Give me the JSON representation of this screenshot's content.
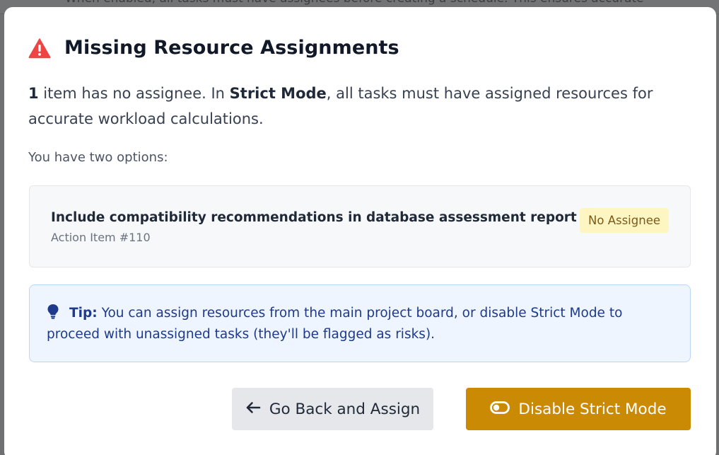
{
  "background": {
    "partial_text": "When enabled, all tasks must have assignees before creating a schedule. This ensures accurate"
  },
  "modal": {
    "title": "Missing Resource Assignments",
    "title_icon": "warning-triangle-icon",
    "summary": {
      "count": "1",
      "text_a": " item has no assignee. In ",
      "mode": "Strict Mode",
      "text_b": ", all tasks must have assigned resources for accurate workload calculations."
    },
    "options_label": "You have two options:",
    "items": [
      {
        "title": "Include compatibility recommendations in database assessment report",
        "subtitle": "Action Item #110",
        "badge": "No Assignee"
      }
    ],
    "tip": {
      "icon": "lightbulb-icon",
      "label": "Tip:",
      "text": "You can assign resources from the main project board, or disable Strict Mode to proceed with unassigned tasks (they'll be flagged as risks)."
    },
    "buttons": {
      "back_label": "Go Back and Assign",
      "back_icon": "arrow-left-icon",
      "disable_label": "Disable Strict Mode",
      "disable_icon": "toggle-icon"
    }
  },
  "colors": {
    "warning": "#ef4444",
    "primary_action": "#ca8a04",
    "tip_bg": "#eef5fe",
    "badge_bg": "#fdf6c3"
  }
}
